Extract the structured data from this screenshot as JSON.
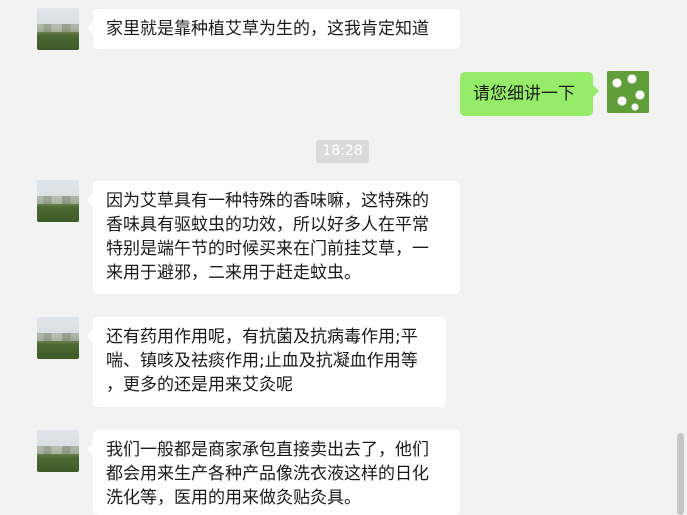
{
  "messages": [
    {
      "side": "left",
      "text": "家里就是靠种植艾草为生的，这我肯定知道"
    },
    {
      "side": "right",
      "text": "请您细讲一下"
    },
    {
      "side": "left",
      "text": "因为艾草具有一种特殊的香味嘛，这特殊的\n香味具有驱蚊虫的功效，所以好多人在平常\n特别是端午节的时候买来在门前挂艾草，一\n来用于避邪，二来用于赶走蚊虫。"
    },
    {
      "side": "left",
      "text": "还有药用作用呢，有抗菌及抗病毒作用;平\n喘、镇咳及祛痰作用;止血及抗凝血作用等\n，更多的还是用来艾灸呢"
    },
    {
      "side": "left",
      "text": "我们一般都是商家承包直接卖出去了，他们\n都会用来生产各种产品像洗衣液这样的日化\n洗化等，医用的用来做灸贴灸具。"
    }
  ],
  "timestamp": "18:28",
  "colors": {
    "background": "#f2f2f2",
    "incoming_bubble": "#ffffff",
    "outgoing_bubble": "#95ec69",
    "timestamp_bg": "#dadada"
  },
  "icons": {
    "contact_avatar": "field-photo-avatar",
    "my_avatar": "white-flowers-avatar"
  }
}
